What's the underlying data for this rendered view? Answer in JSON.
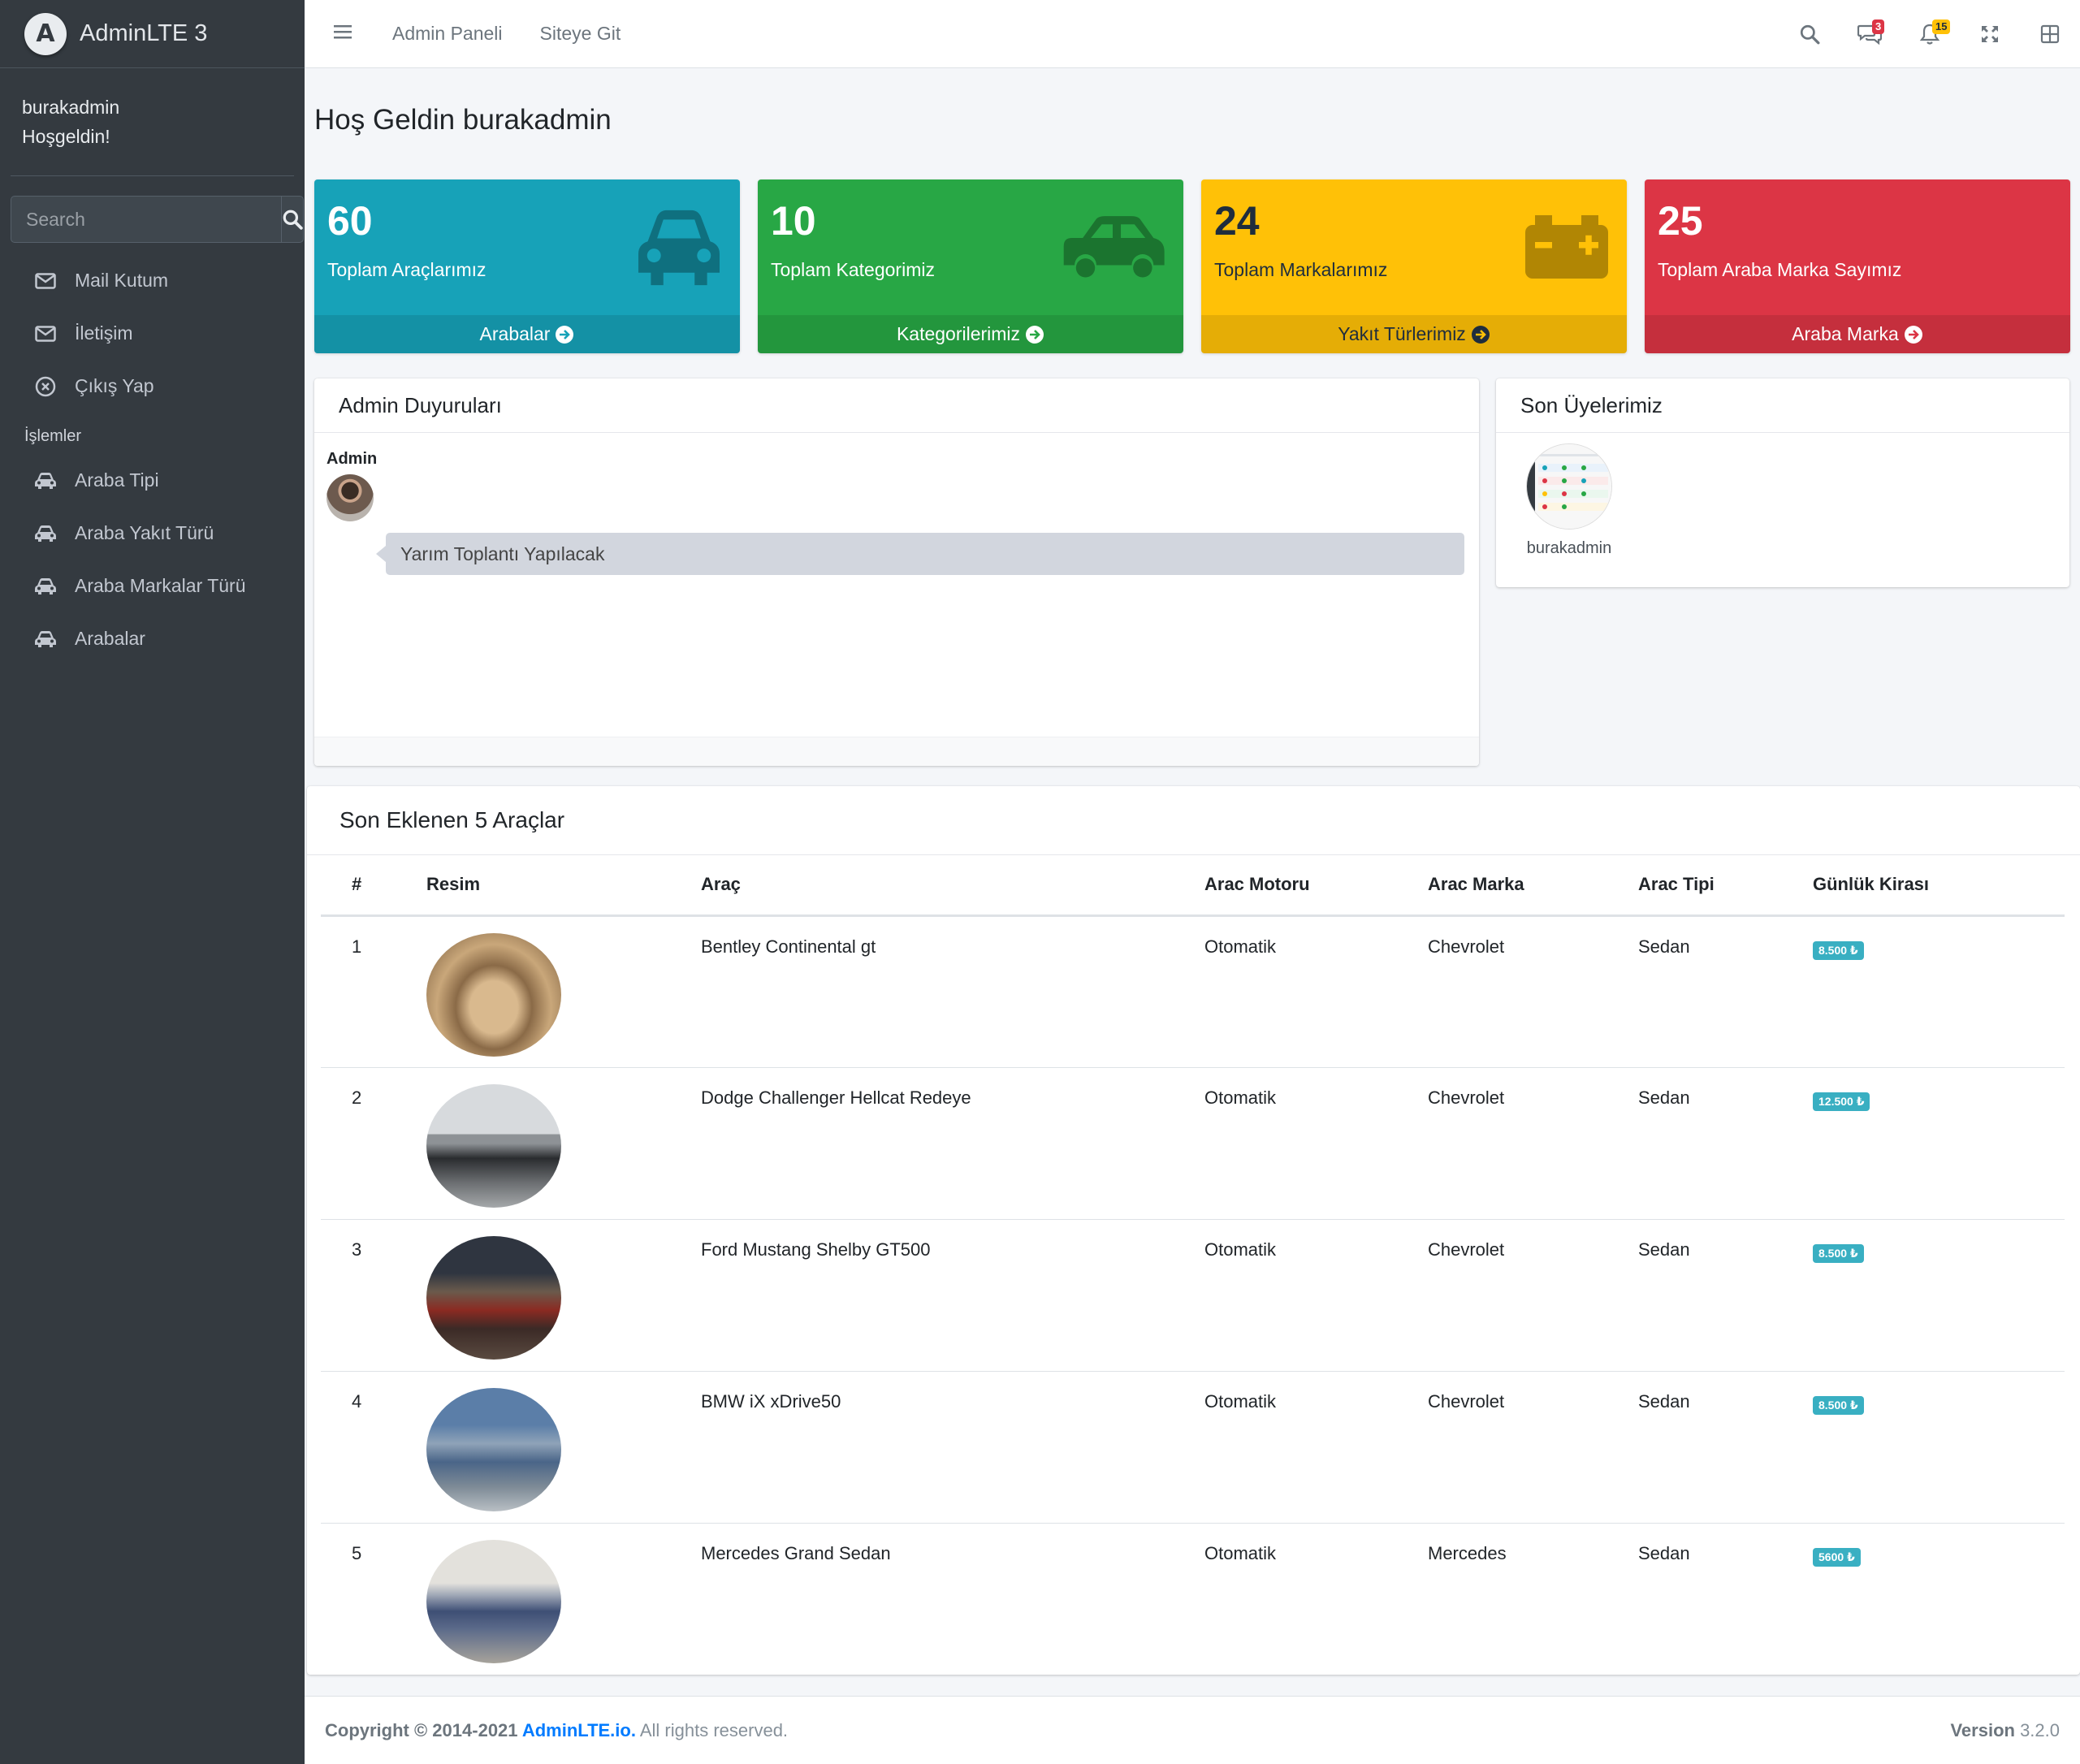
{
  "brand": {
    "logo_letter": "A",
    "name": "AdminLTE 3"
  },
  "user": {
    "name": "burakadmin",
    "greeting": "Hoşgeldin!"
  },
  "sidebar": {
    "search_placeholder": "Search",
    "items": [
      {
        "label": "Mail Kutum",
        "icon": "envelope-icon"
      },
      {
        "label": "İletişim",
        "icon": "envelope-icon"
      },
      {
        "label": "Çıkış Yap",
        "icon": "times-circle-icon"
      }
    ],
    "section_header": "İşlemler",
    "section_items": [
      {
        "label": "Araba Tipi",
        "icon": "car-icon"
      },
      {
        "label": "Araba Yakıt Türü",
        "icon": "car-icon"
      },
      {
        "label": "Araba Markalar Türü",
        "icon": "car-icon"
      },
      {
        "label": "Arabalar",
        "icon": "car-icon"
      }
    ]
  },
  "topbar": {
    "links": [
      "Admin Paneli",
      "Siteye Git"
    ],
    "messages_count": "3",
    "notifications_count": "15"
  },
  "page": {
    "title": "Hoş Geldin burakadmin"
  },
  "stat_boxes": [
    {
      "value": "60",
      "label": "Toplam Araçlarımız",
      "footer": "Arabalar",
      "color": "#17a2b8",
      "icon": "car-icon"
    },
    {
      "value": "10",
      "label": "Toplam Kategorimiz",
      "footer": "Kategorilerimiz",
      "color": "#28a745",
      "icon": "car-side-icon"
    },
    {
      "value": "24",
      "label": "Toplam Markalarımız",
      "footer": "Yakıt Türlerimiz",
      "color": "#ffc107",
      "icon": "battery-icon"
    },
    {
      "value": "25",
      "label": "Toplam Araba Marka Sayımız",
      "footer": "Araba Marka",
      "color": "#dc3545",
      "icon": "none"
    }
  ],
  "announcements": {
    "title": "Admin Duyuruları",
    "author": "Admin",
    "message": "Yarım Toplantı Yapılacak"
  },
  "members": {
    "title": "Son Üyelerimiz",
    "items": [
      {
        "name": "burakadmin"
      }
    ]
  },
  "cars_table": {
    "title": "Son Eklenen 5 Araçlar",
    "columns": [
      "#",
      "Resim",
      "Araç",
      "Arac Motoru",
      "Arac Marka",
      "Arac Tipi",
      "Günlük Kirası"
    ],
    "rows": [
      {
        "no": "1",
        "name": "Bentley Continental gt",
        "engine": "Otomatik",
        "brand": "Chevrolet",
        "type": "Sedan",
        "price": "8.500 ₺"
      },
      {
        "no": "2",
        "name": "Dodge Challenger Hellcat Redeye",
        "engine": "Otomatik",
        "brand": "Chevrolet",
        "type": "Sedan",
        "price": "12.500 ₺"
      },
      {
        "no": "3",
        "name": "Ford Mustang Shelby GT500",
        "engine": "Otomatik",
        "brand": "Chevrolet",
        "type": "Sedan",
        "price": "8.500 ₺"
      },
      {
        "no": "4",
        "name": "BMW iX xDrive50",
        "engine": "Otomatik",
        "brand": "Chevrolet",
        "type": "Sedan",
        "price": "8.500 ₺"
      },
      {
        "no": "5",
        "name": "Mercedes Grand Sedan",
        "engine": "Otomatik",
        "brand": "Mercedes",
        "type": "Sedan",
        "price": "5600 ₺"
      }
    ]
  },
  "footer": {
    "copyright_prefix": "Copyright © 2014-2021 ",
    "copyright_link": "AdminLTE.io.",
    "rights": " All rights reserved.",
    "version_label": "Version",
    "version_value": " 3.2.0"
  }
}
